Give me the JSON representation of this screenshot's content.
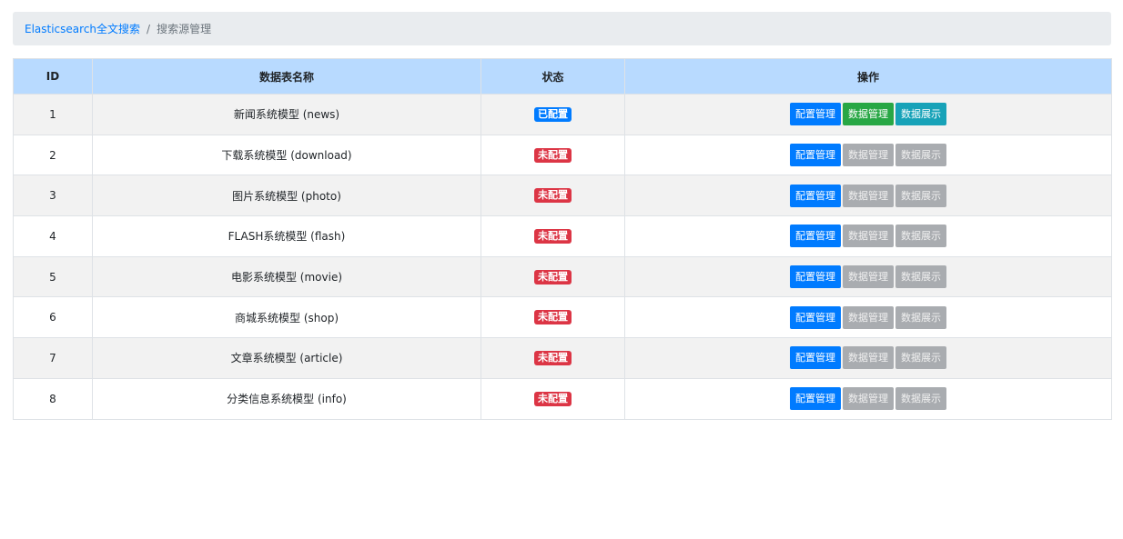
{
  "breadcrumb": {
    "home": "Elasticsearch全文搜索",
    "separator": "/",
    "current": "搜索源管理"
  },
  "table": {
    "headers": {
      "id": "ID",
      "name": "数据表名称",
      "status": "状态",
      "actions": "操作"
    },
    "buttons": {
      "config": "配置管理",
      "data": "数据管理",
      "display": "数据展示"
    },
    "rows": [
      {
        "id": "1",
        "name": "新闻系统模型 (news)",
        "status": "已配置",
        "configured": true
      },
      {
        "id": "2",
        "name": "下载系统模型 (download)",
        "status": "未配置",
        "configured": false
      },
      {
        "id": "3",
        "name": "图片系统模型 (photo)",
        "status": "未配置",
        "configured": false
      },
      {
        "id": "4",
        "name": "FLASH系统模型 (flash)",
        "status": "未配置",
        "configured": false
      },
      {
        "id": "5",
        "name": "电影系统模型 (movie)",
        "status": "未配置",
        "configured": false
      },
      {
        "id": "6",
        "name": "商城系统模型 (shop)",
        "status": "未配置",
        "configured": false
      },
      {
        "id": "7",
        "name": "文章系统模型 (article)",
        "status": "未配置",
        "configured": false
      },
      {
        "id": "8",
        "name": "分类信息系统模型 (info)",
        "status": "未配置",
        "configured": false
      }
    ]
  },
  "colors": {
    "primary": "#007bff",
    "success": "#28a745",
    "info": "#17a2b8",
    "danger": "#dc3545",
    "disabled": "#a9acb0",
    "header_bg": "#b8daff"
  }
}
